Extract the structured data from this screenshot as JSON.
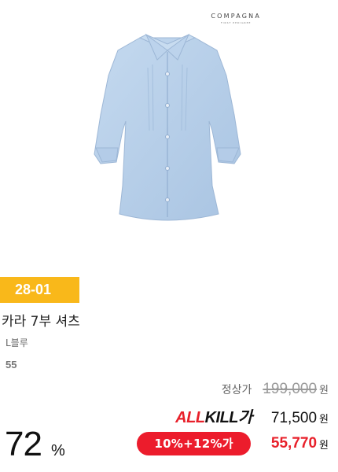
{
  "brand": {
    "name": "COMPAGNA",
    "tagline": "FIRST PEDIGREE"
  },
  "product": {
    "badge": "28-01",
    "name": "카라 7부 셔츠",
    "color": "L블루",
    "size": "55",
    "image_color": "#b8d0ea"
  },
  "pricing": {
    "regular_label": "정상가",
    "regular_price": "199,000",
    "allkill_logo": {
      "part1": "ALL",
      "part2": "KILL",
      "part3": "가"
    },
    "allkill_price": "71,500",
    "coupon": "10%+12%가",
    "final_price": "55,770",
    "currency": "원",
    "discount_percent": "72",
    "discount_unit": "%"
  },
  "colors": {
    "badge": "#f9b81a",
    "accent_red": "#ec1c2c"
  }
}
